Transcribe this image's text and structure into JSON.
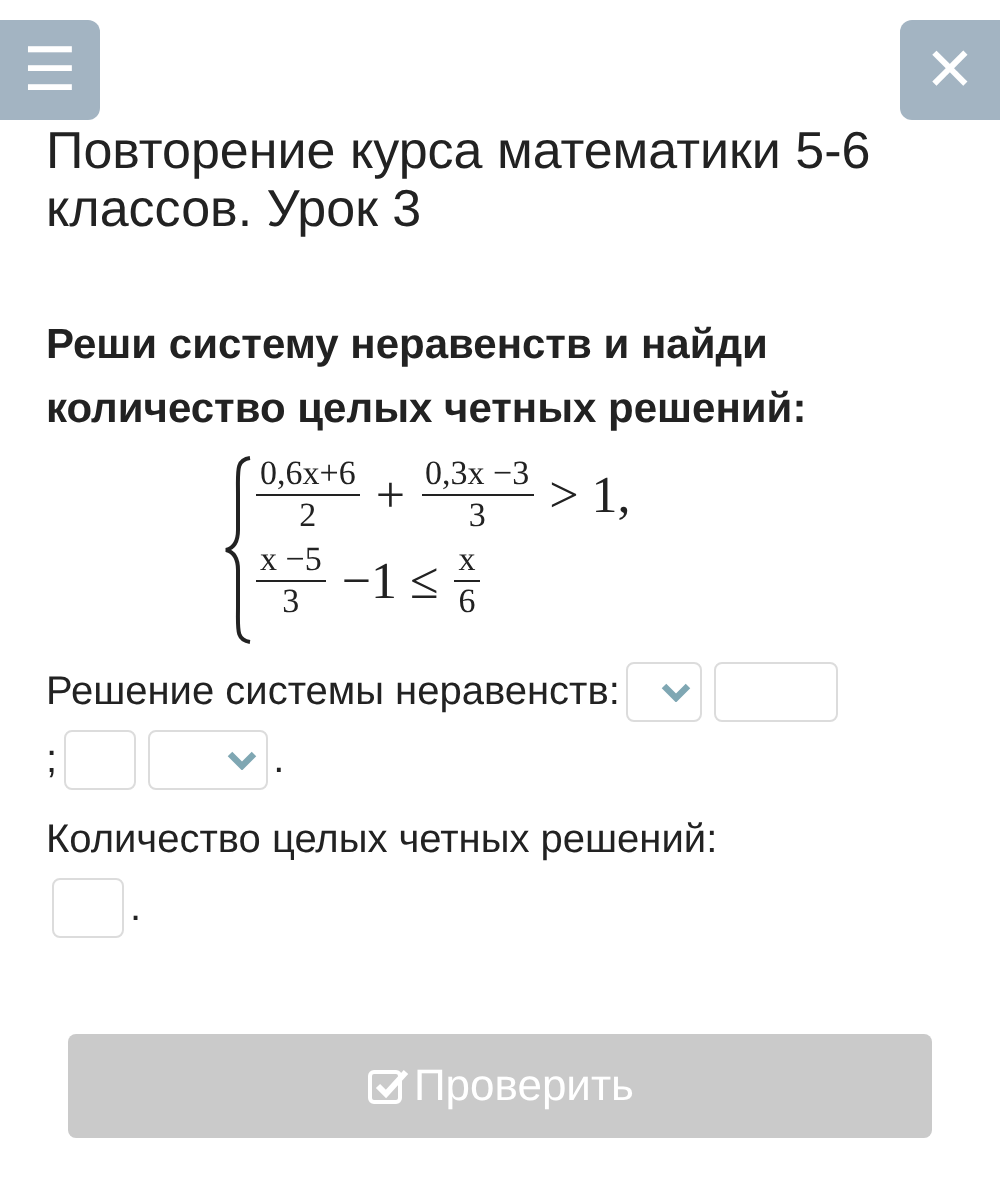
{
  "header": {
    "menu_button": "☰",
    "close_button": "✕"
  },
  "title": "Повторение курса математики 5-6 классов. Урок 3",
  "question": "Реши систему неравенств и найди количество целых четных решений:",
  "system": [
    {
      "parts": [
        {
          "kind": "fraction",
          "num": "0,6x+6",
          "den": "2"
        },
        {
          "kind": "op",
          "text": "+"
        },
        {
          "kind": "fraction",
          "num": "0,3x −3",
          "den": "3"
        },
        {
          "kind": "op",
          "text": "> 1,"
        }
      ]
    },
    {
      "parts": [
        {
          "kind": "fraction",
          "num": "x −5",
          "den": "3"
        },
        {
          "kind": "op",
          "text": "−1 ≤"
        },
        {
          "kind": "fraction",
          "num": "x",
          "den": "6"
        }
      ]
    }
  ],
  "answers": [
    {
      "lines": [
        [
          {
            "kind": "text",
            "text": "Решение системы неравенств:"
          },
          {
            "kind": "select"
          },
          {
            "kind": "input"
          }
        ],
        [
          {
            "kind": "text",
            "text": ";"
          },
          {
            "kind": "input"
          },
          {
            "kind": "select"
          },
          {
            "kind": "text",
            "text": "."
          }
        ]
      ]
    },
    {
      "lines": [
        [
          {
            "kind": "text",
            "text": "Количество целых четных решений:"
          }
        ],
        [
          {
            "kind": "input"
          },
          {
            "kind": "text",
            "text": "."
          }
        ]
      ]
    }
  ],
  "check_button": {
    "label": "Проверить",
    "disabled": true
  }
}
